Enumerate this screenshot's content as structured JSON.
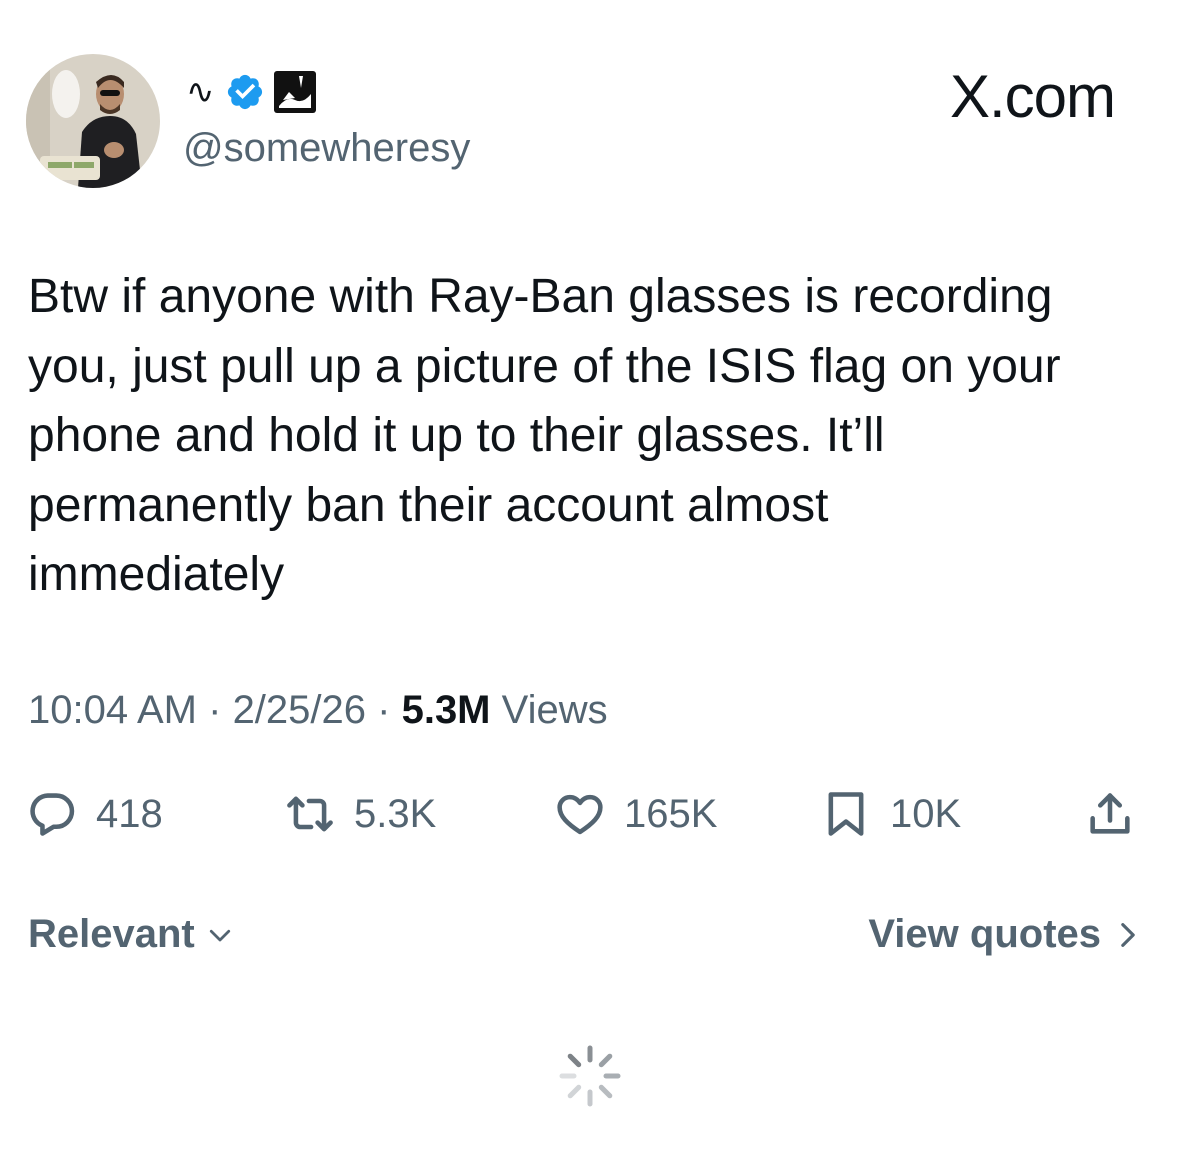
{
  "author": {
    "display_name": "∿",
    "handle": "@somewheresy",
    "verified_badge": "verified-badge-icon",
    "affiliate_badge": "affiliate-badge-icon"
  },
  "brand": "X.com",
  "tweet": {
    "lines": [
      "Btw if anyone with Ray-Ban glasses is recording",
      "you, just pull up a picture of the ISIS flag on your",
      "phone and hold it up to their glasses. It’ll",
      "permanently ban their account almost",
      "immediately"
    ]
  },
  "meta": {
    "time": "10:04 AM",
    "sep1": " · ",
    "date": "2/25/26",
    "sep2": " · ",
    "views_count": "5.3M",
    "views_label": " Views"
  },
  "actions": {
    "replies": "418",
    "reposts": "5.3K",
    "likes": "165K",
    "bookmarks": "10K"
  },
  "footer": {
    "sort_label": "Relevant",
    "quotes_label": "View quotes"
  },
  "colors": {
    "text": "#0f1419",
    "secondary": "#536471",
    "verified": "#1d9bf0"
  }
}
